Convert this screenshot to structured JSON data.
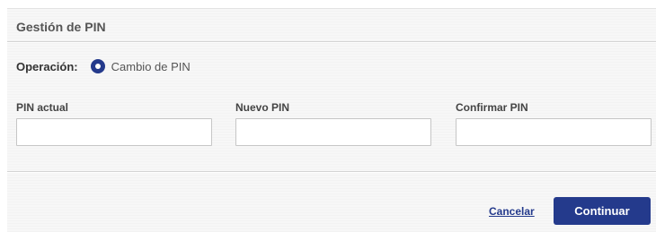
{
  "panel": {
    "title": "Gestión de PIN"
  },
  "operation": {
    "label": "Operación:",
    "option_label": "Cambio de PIN",
    "selected": true
  },
  "fields": [
    {
      "label": "PIN actual",
      "value": "",
      "placeholder": ""
    },
    {
      "label": "Nuevo PIN",
      "value": "",
      "placeholder": ""
    },
    {
      "label": "Confirmar PIN",
      "value": "",
      "placeholder": ""
    }
  ],
  "actions": {
    "cancel_label": "Cancelar",
    "continue_label": "Continuar"
  },
  "colors": {
    "accent": "#243a8c",
    "panel_background": "#f5f5f5"
  },
  "icons": {
    "radio": "radio-selected-icon"
  }
}
